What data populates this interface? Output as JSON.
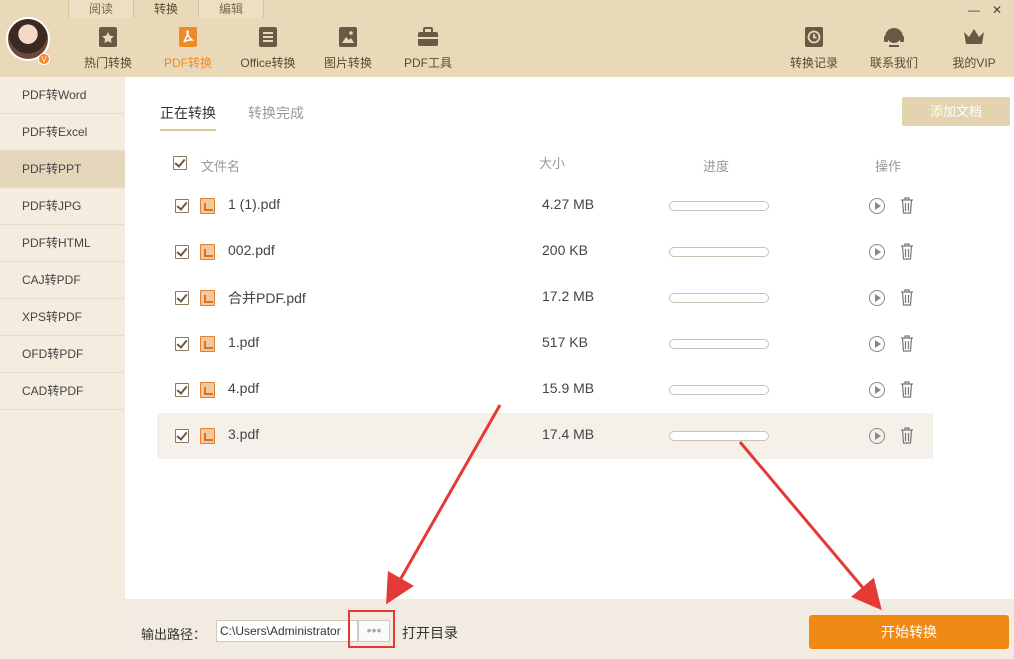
{
  "window": {
    "top_tabs": [
      "阅读",
      "转换",
      "编辑"
    ],
    "active_top_tab": 1,
    "minimize": "—",
    "close": "✕"
  },
  "nav": {
    "left": [
      {
        "label": "热门转换",
        "icon": "bookmark-star-icon"
      },
      {
        "label": "PDF转换",
        "icon": "pdf-icon"
      },
      {
        "label": "Office转换",
        "icon": "document-icon"
      },
      {
        "label": "图片转换",
        "icon": "image-icon"
      },
      {
        "label": "PDF工具",
        "icon": "toolbox-icon"
      }
    ],
    "active_index": 1,
    "right": [
      {
        "label": "转换记录",
        "icon": "clock-icon"
      },
      {
        "label": "联系我们",
        "icon": "headset-icon"
      },
      {
        "label": "我的VIP",
        "icon": "crown-icon"
      }
    ]
  },
  "avatar": {
    "badge": "V"
  },
  "sidebar": {
    "items": [
      "PDF转Word",
      "PDF转Excel",
      "PDF转PPT",
      "PDF转JPG",
      "PDF转HTML",
      "CAJ转PDF",
      "XPS转PDF",
      "OFD转PDF",
      "CAD转PDF"
    ],
    "active_index": 2
  },
  "main": {
    "tabs": [
      "正在转换",
      "转换完成"
    ],
    "active_tab": 0,
    "add_button": "添加文档",
    "columns": {
      "name": "文件名",
      "size": "大小",
      "progress": "进度",
      "ops": "操作"
    },
    "files": [
      {
        "name": "1 (1).pdf",
        "size": "4.27 MB",
        "progress": 0,
        "checked": true
      },
      {
        "name": "002.pdf",
        "size": "200 KB",
        "progress": 0,
        "checked": true
      },
      {
        "name": "合并PDF.pdf",
        "size": "17.2 MB",
        "progress": 0,
        "checked": true
      },
      {
        "name": "1.pdf",
        "size": "517 KB",
        "progress": 0,
        "checked": true
      },
      {
        "name": "4.pdf",
        "size": "15.9 MB",
        "progress": 0,
        "checked": true
      },
      {
        "name": "3.pdf",
        "size": "17.4 MB",
        "progress": 0,
        "checked": true
      }
    ],
    "highlighted_row": 5
  },
  "bottom": {
    "output_label": "输出路径：",
    "output_path": "C:\\Users\\Administrator",
    "browse": "•••",
    "open_dir": "打开目录",
    "start_button": "开始转换"
  },
  "colors": {
    "accent": "#f08a14",
    "topbar": "#e9d9b8",
    "sidebar": "#f3ecdf",
    "annotation": "#e53935"
  }
}
